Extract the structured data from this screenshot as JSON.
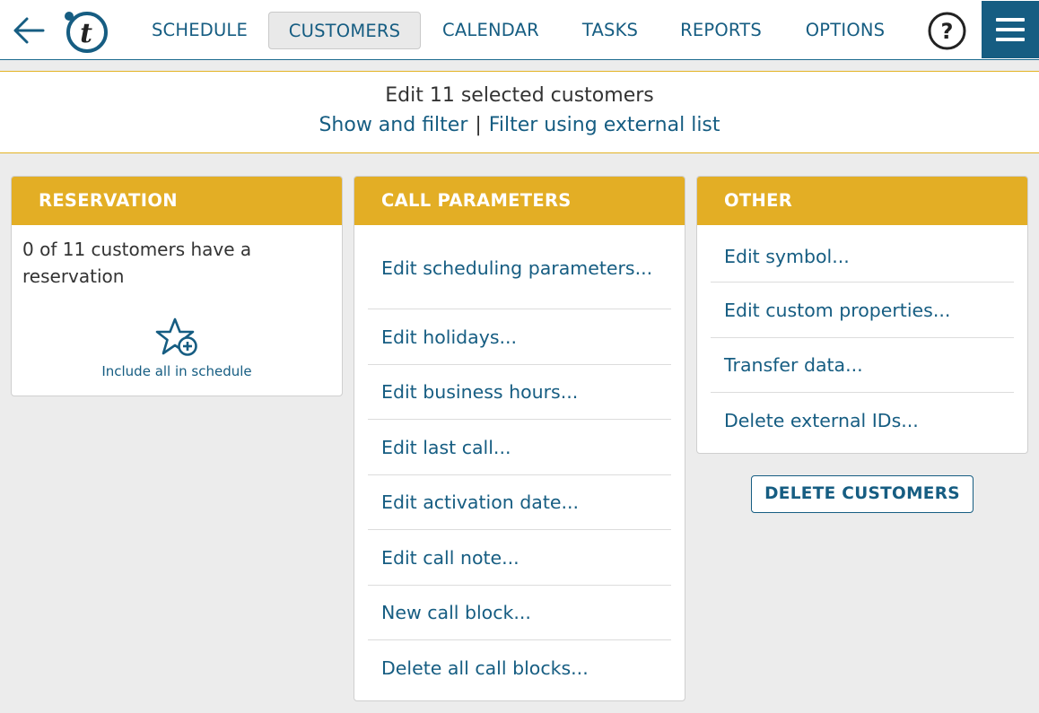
{
  "nav": {
    "items": [
      "SCHEDULE",
      "CUSTOMERS",
      "CALENDAR",
      "TASKS",
      "REPORTS",
      "OPTIONS"
    ],
    "active": "CUSTOMERS",
    "help_label": "?"
  },
  "header": {
    "title": "Edit 11 selected customers",
    "link_show_filter": "Show and filter",
    "separator": "|",
    "link_external_list": "Filter using external list"
  },
  "reservation": {
    "title": "RESERVATION",
    "status_text": "0 of 11 customers have a reservation",
    "include_label": "Include all in schedule",
    "icon": "star-plus-icon"
  },
  "call_parameters": {
    "title": "CALL PARAMETERS",
    "items": [
      "Edit scheduling parameters...",
      "Edit holidays...",
      "Edit business hours...",
      "Edit last call...",
      "Edit activation date...",
      "Edit call note...",
      "New call block...",
      "Delete all call blocks..."
    ]
  },
  "other": {
    "title": "OTHER",
    "items": [
      "Edit symbol...",
      "Edit custom properties...",
      "Transfer data...",
      "Delete external IDs..."
    ]
  },
  "delete_button_label": "DELETE CUSTOMERS",
  "colors": {
    "accent": "#165d82",
    "panel_header": "#e3ae25",
    "background": "#ececec"
  }
}
